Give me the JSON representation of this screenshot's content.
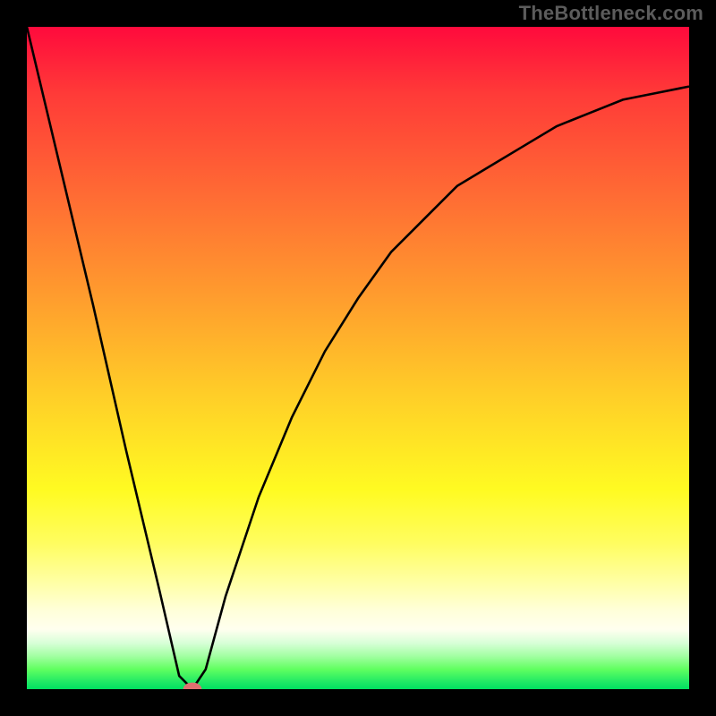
{
  "watermark": "TheBottleneck.com",
  "chart_data": {
    "type": "line",
    "title": "",
    "xlabel": "",
    "ylabel": "",
    "xlim": [
      0,
      100
    ],
    "ylim": [
      0,
      100
    ],
    "gradient_colors": {
      "top": "#ff0a3c",
      "mid_upper": "#ff9a2e",
      "mid": "#fffb22",
      "mid_lower": "#ffffef",
      "bottom": "#00e060"
    },
    "series": [
      {
        "name": "bottleneck-curve",
        "x": [
          0,
          5,
          10,
          15,
          20,
          23,
          25,
          27,
          30,
          35,
          40,
          45,
          50,
          55,
          60,
          65,
          70,
          75,
          80,
          85,
          90,
          95,
          100
        ],
        "y": [
          100,
          79,
          58,
          36,
          15,
          2,
          0,
          3,
          14,
          29,
          41,
          51,
          59,
          66,
          71,
          76,
          79,
          82,
          85,
          87,
          89,
          90,
          91
        ]
      }
    ],
    "marker": {
      "x": 25,
      "y": 0,
      "color": "#e07070"
    }
  }
}
